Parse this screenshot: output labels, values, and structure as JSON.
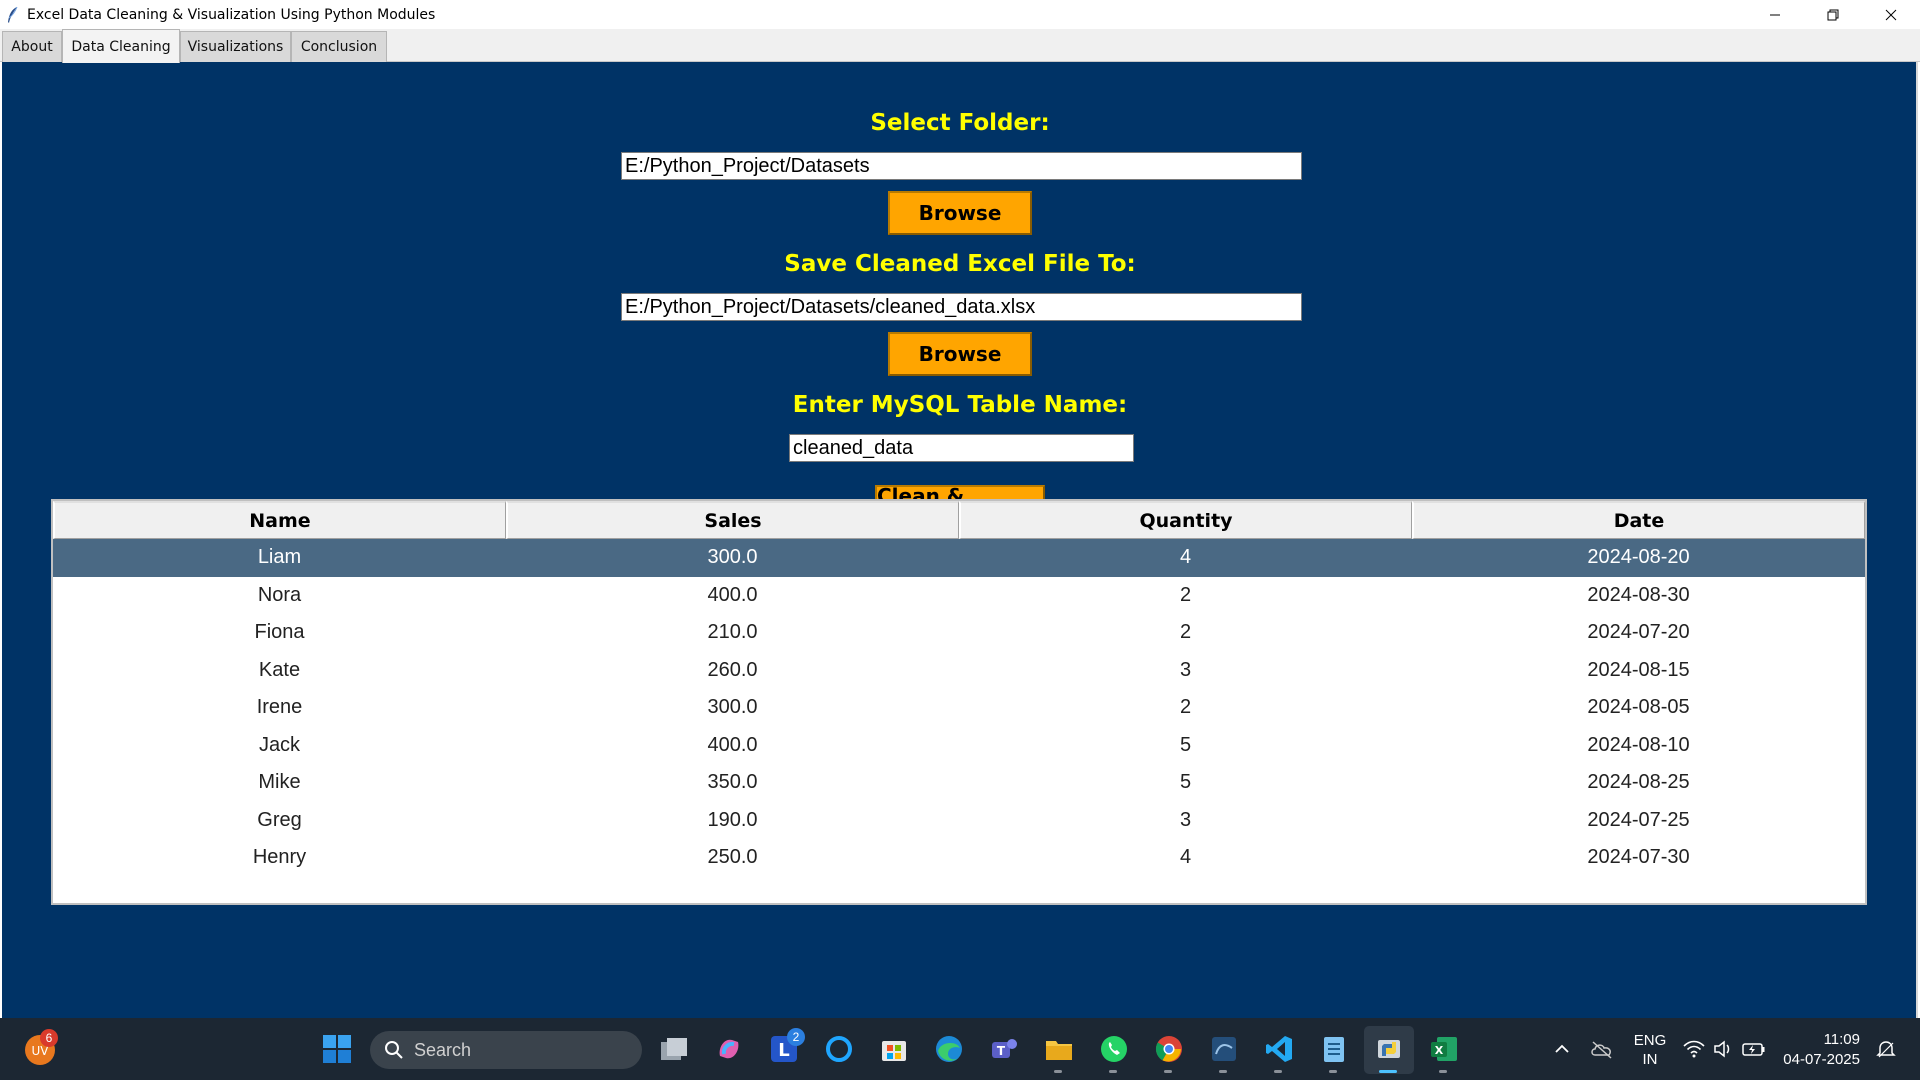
{
  "window": {
    "title": "Excel Data Cleaning & Visualization Using Python Modules"
  },
  "tabs": [
    {
      "label": "About"
    },
    {
      "label": "Data Cleaning"
    },
    {
      "label": "Visualizations"
    },
    {
      "label": "Conclusion"
    }
  ],
  "active_tab": "Data Cleaning",
  "form": {
    "folder_label": "Select Folder:",
    "folder_value": "E:/Python_Project/Datasets",
    "browse1_label": "Browse",
    "save_label": "Save Cleaned Excel File To:",
    "save_value": "E:/Python_Project/Datasets/cleaned_data.xlsx",
    "browse2_label": "Browse",
    "table_label": "Enter MySQL Table Name:",
    "table_value": "cleaned_data",
    "clean_upload_label": "Clean & Upload"
  },
  "table": {
    "columns": [
      "Name",
      "Sales",
      "Quantity",
      "Date"
    ],
    "rows": [
      [
        "Liam",
        "300.0",
        "4",
        "2024-08-20"
      ],
      [
        "Nora",
        "400.0",
        "2",
        "2024-08-30"
      ],
      [
        "Fiona",
        "210.0",
        "2",
        "2024-07-20"
      ],
      [
        "Kate",
        "260.0",
        "3",
        "2024-08-15"
      ],
      [
        "Irene",
        "300.0",
        "2",
        "2024-08-05"
      ],
      [
        "Jack",
        "400.0",
        "5",
        "2024-08-10"
      ],
      [
        "Mike",
        "350.0",
        "5",
        "2024-08-25"
      ],
      [
        "Greg",
        "190.0",
        "3",
        "2024-07-25"
      ],
      [
        "Henry",
        "250.0",
        "4",
        "2024-07-30"
      ]
    ],
    "selected_row": 0
  },
  "taskbar": {
    "search_placeholder": "Search",
    "notification_badge": "6",
    "lightshot_badge": "2",
    "language": "ENG",
    "region": "IN",
    "time": "11:09",
    "date": "04-07-2025"
  },
  "colors": {
    "panel_bg": "#003366",
    "label_yellow": "#ffff00",
    "button_orange": "#ffa500",
    "selected_row": "#4a6984"
  }
}
